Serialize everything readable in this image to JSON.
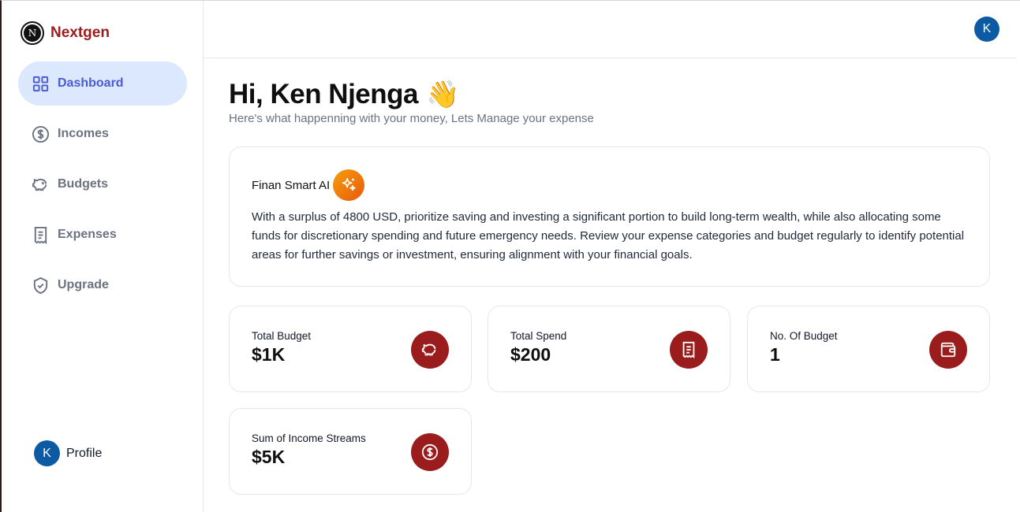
{
  "brand": {
    "name": "Nextgen",
    "logo_letter": "N"
  },
  "sidebar": {
    "items": [
      {
        "label": "Dashboard",
        "icon": "grid-icon",
        "active": true
      },
      {
        "label": "Incomes",
        "icon": "dollar-circle-icon",
        "active": false
      },
      {
        "label": "Budgets",
        "icon": "piggy-bank-icon",
        "active": false
      },
      {
        "label": "Expenses",
        "icon": "receipt-icon",
        "active": false
      },
      {
        "label": "Upgrade",
        "icon": "shield-check-icon",
        "active": false
      }
    ],
    "profile": {
      "initial": "K",
      "label": "Profile"
    }
  },
  "header": {
    "avatar_initial": "K"
  },
  "main": {
    "greeting": "Hi, Ken Njenga",
    "greeting_emoji": "👋",
    "subtitle": "Here's what happenning with your money, Lets Manage your expense",
    "ai_card": {
      "title": "Finan Smart AI",
      "text": "With a surplus of 4800 USD, prioritize saving and investing a significant portion to build long-term wealth, while also allocating some funds for discretionary spending and future emergency needs. Review your expense categories and budget regularly to identify potential areas for further savings or investment, ensuring alignment with your financial goals."
    },
    "stats": [
      {
        "label": "Total Budget",
        "value": "$1K",
        "icon": "piggy-bank-icon"
      },
      {
        "label": "Total Spend",
        "value": "$200",
        "icon": "receipt-icon"
      },
      {
        "label": "No. Of Budget",
        "value": "1",
        "icon": "wallet-icon"
      },
      {
        "label": "Sum of Income Streams",
        "value": "$5K",
        "icon": "dollar-circle-icon"
      }
    ]
  },
  "colors": {
    "accent": "#9b1c1c",
    "active_bg": "#dbe8fd",
    "active_text": "#4b5bd1",
    "avatar": "#0b5aa3"
  }
}
